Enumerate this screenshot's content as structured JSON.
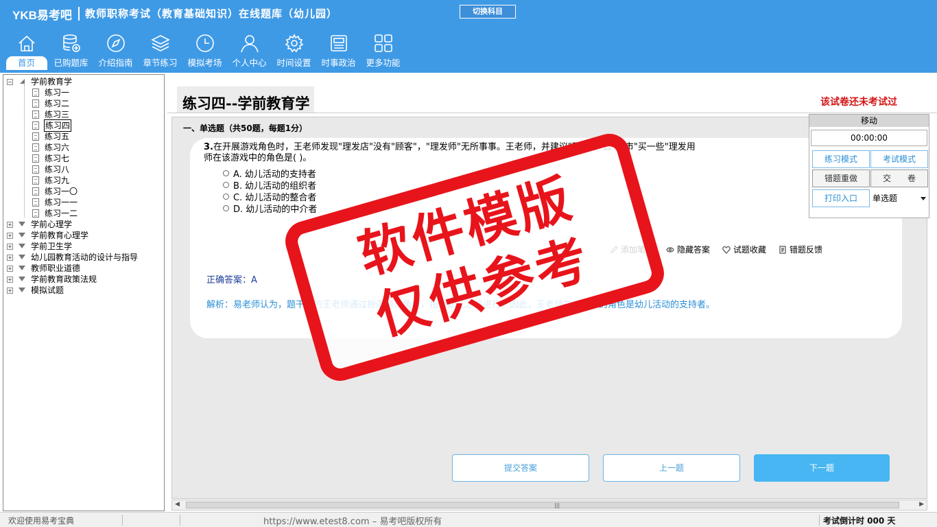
{
  "header": {
    "logo": "YKB易考吧",
    "title": "教师职称考试（教育基础知识）在线题库（幼儿园）",
    "switch_label": "切换科目",
    "nav": [
      {
        "label": "首页",
        "icon": "home-icon"
      },
      {
        "label": "已购题库",
        "icon": "database-icon"
      },
      {
        "label": "介绍指南",
        "icon": "compass-icon"
      },
      {
        "label": "章节练习",
        "icon": "layers-icon"
      },
      {
        "label": "模拟考场",
        "icon": "clock-icon"
      },
      {
        "label": "个人中心",
        "icon": "user-icon"
      },
      {
        "label": "时间设置",
        "icon": "gear-icon"
      },
      {
        "label": "时事政治",
        "icon": "news-icon"
      },
      {
        "label": "更多功能",
        "icon": "grid-icon"
      }
    ]
  },
  "tree": {
    "root": "学前教育学",
    "children": [
      "练习一",
      "练习二",
      "练习三",
      "练习四",
      "练习五",
      "练习六",
      "练习七",
      "练习八",
      "练习九",
      "练习一〇",
      "练习一一",
      "练习一二"
    ],
    "selected": "练习四",
    "others": [
      "学前心理学",
      "学前教育心理学",
      "学前卫生学",
      "幼儿园教育活动的设计与指导",
      "教师职业道德",
      "学前教育政策法规",
      "模拟试题"
    ]
  },
  "main": {
    "paper_title": "练习四--学前教育学",
    "status_notice": "该试卷还未考试过",
    "section_header": "一、单选题（共50题，每题1分）",
    "question": {
      "number": "3.",
      "line1": "在开展游戏角色时，王老师发现\"理发店\"没有\"顾客\"，\"理发师\"无所事事。王老师",
      "line1_end": "，并建议\"理发师\"去\"超市\"买一些\"理发用",
      "line2": "师在该游戏中的角色是(  )。",
      "options": [
        "A. 幼儿活动的支持者",
        "B. 幼儿活动的组织者",
        "C. 幼儿活动的整合者",
        "D. 幼儿活动的中介者"
      ]
    },
    "tools": [
      {
        "label": "添加笔记",
        "icon": "pencil-icon"
      },
      {
        "label": "隐藏答案",
        "icon": "eye-icon"
      },
      {
        "label": "试题收藏",
        "icon": "heart-icon"
      },
      {
        "label": "错题反馈",
        "icon": "feedback-icon"
      }
    ],
    "answer": "正确答案：A",
    "analysis": "解析：易老师认为，题干中的王老师通过扮演游戏角色，指导幼儿游戏进行，因此，王老师在游戏中的角色是幼儿活动的支持者。",
    "buttons": {
      "submit": "提交答案",
      "prev": "上一题",
      "next": "下一题"
    }
  },
  "panel": {
    "header": "移动",
    "timer": "00:00:00",
    "practice_mode": "练习模式",
    "exam_mode": "考试模式",
    "redo_wrong": "错题重做",
    "submit_paper": "交　　卷",
    "print": "打印入口",
    "question_type": "单选题"
  },
  "watermark": {
    "line1": "软件模版",
    "line2": "仅供参考"
  },
  "statusbar": {
    "welcome": "欢迎使用易考宝典",
    "copyright": "https://www.etest8.com – 易考吧版权所有",
    "countdown": "考试倒计时 000 天"
  }
}
